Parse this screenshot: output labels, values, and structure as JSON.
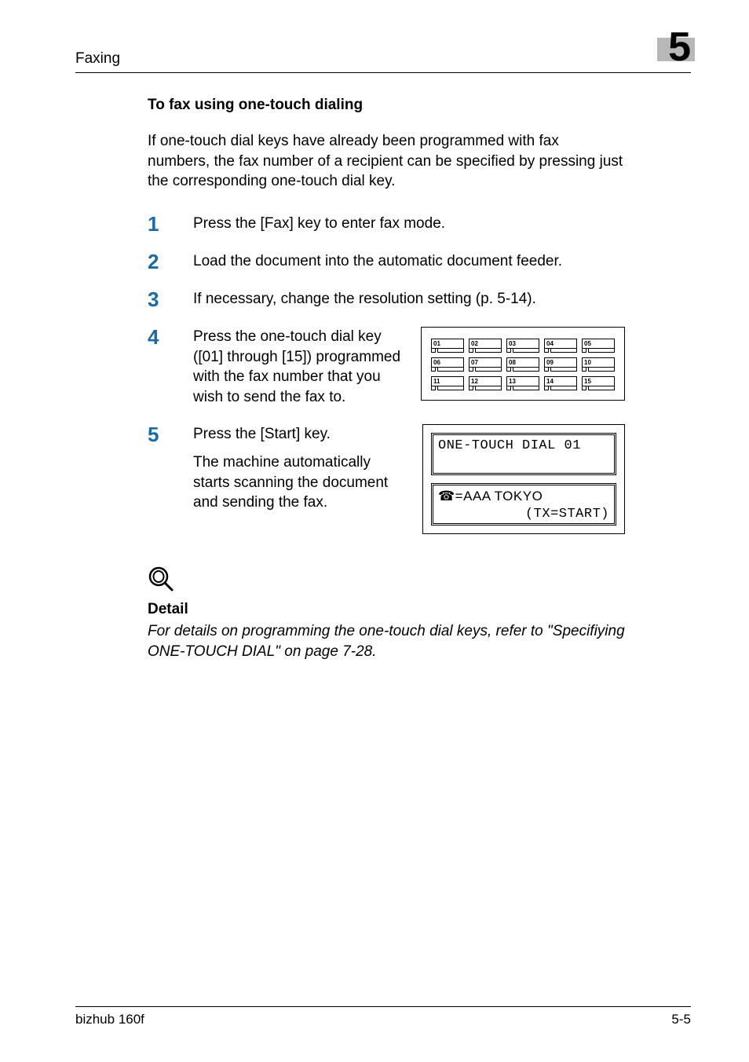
{
  "header": {
    "section": "Faxing",
    "chapter_number": "5"
  },
  "section": {
    "title": "To fax using one-touch dialing",
    "intro": "If one-touch dial keys have already been programmed with fax numbers, the fax number of a recipient can be specified by pressing just the corresponding one-touch dial key."
  },
  "steps": {
    "s1": {
      "num": "1",
      "text": "Press the [Fax] key to enter fax mode."
    },
    "s2": {
      "num": "2",
      "text": "Load the document into the automatic document feeder."
    },
    "s3": {
      "num": "3",
      "text": "If necessary, change the resolution setting (p. 5-14)."
    },
    "s4": {
      "num": "4",
      "text": "Press the one-touch dial key ([01] through [15]) programmed with the fax number that you wish to send the fax to."
    },
    "s5": {
      "num": "5",
      "text": "Press the [Start] key.",
      "text2": "The machine automatically starts scanning the document and sending the fax."
    }
  },
  "keypad": {
    "rows": [
      [
        "01",
        "02",
        "03",
        "04",
        "05"
      ],
      [
        "06",
        "07",
        "08",
        "09",
        "10"
      ],
      [
        "11",
        "12",
        "13",
        "14",
        "15"
      ]
    ]
  },
  "lcd": {
    "line1": "ONE-TOUCH DIAL 01",
    "line2a": "☎=AAA TOKYO",
    "line2b": "(TX=START)"
  },
  "detail": {
    "title": "Detail",
    "text": "For details on programming the one-touch dial keys, refer to \"Specifiying ONE-TOUCH DIAL\" on page 7-28."
  },
  "footer": {
    "left": "bizhub 160f",
    "right": "5-5"
  }
}
